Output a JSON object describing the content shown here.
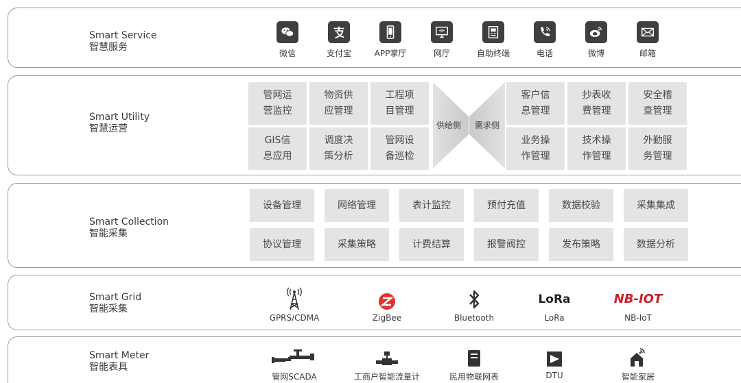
{
  "layers": {
    "service": {
      "en": "Smart Service",
      "zh": "智慧服务"
    },
    "utility": {
      "en": "Smart Utility",
      "zh": "智慧运营"
    },
    "collection": {
      "en": "Smart Collection",
      "zh": "智能采集"
    },
    "grid": {
      "en": "Smart Grid",
      "zh": "智能采集"
    },
    "meter": {
      "en": "Smart Meter",
      "zh": "智能表具"
    }
  },
  "service_items": [
    {
      "label": "微信",
      "icon": "wechat-icon"
    },
    {
      "label": "支付宝",
      "icon": "alipay-icon"
    },
    {
      "label": "APP掌厅",
      "icon": "mobile-app-icon"
    },
    {
      "label": "网厅",
      "icon": "monitor-icon"
    },
    {
      "label": "自助终端",
      "icon": "kiosk-icon"
    },
    {
      "label": "电话",
      "icon": "phone-icon"
    },
    {
      "label": "微博",
      "icon": "weibo-icon"
    },
    {
      "label": "邮箱",
      "icon": "mail-icon"
    }
  ],
  "utility": {
    "supply_side": "供给侧",
    "demand_side": "需求侧",
    "left_cells": [
      [
        "管网运",
        "营监控"
      ],
      [
        "物资供",
        "应管理"
      ],
      [
        "工程项",
        "目管理"
      ],
      [
        "GIS信",
        "息应用"
      ],
      [
        "调度决",
        "策分析"
      ],
      [
        "管网设",
        "备巡检"
      ]
    ],
    "right_cells": [
      [
        "客户信",
        "息管理"
      ],
      [
        "抄表收",
        "费管理"
      ],
      [
        "安全稽",
        "查管理"
      ],
      [
        "业务操",
        "作管理"
      ],
      [
        "技术操",
        "作管理"
      ],
      [
        "外勤服",
        "务管理"
      ]
    ]
  },
  "collection_cells": [
    "设备管理",
    "网络管理",
    "表计监控",
    "预付充值",
    "数据校验",
    "采集集成",
    "协议管理",
    "采集策略",
    "计费结算",
    "报警阀控",
    "发布策略",
    "数据分析"
  ],
  "grid_items": [
    {
      "label": "GPRS/CDMA",
      "icon": "cell-tower-icon"
    },
    {
      "label": "ZigBee",
      "icon": "zigbee-icon"
    },
    {
      "label": "Bluetooth",
      "icon": "bluetooth-icon"
    },
    {
      "label": "LoRa",
      "icon": "lora-logo",
      "logo_text": "LoRa"
    },
    {
      "label": "NB-IoT",
      "icon": "nbiot-logo",
      "logo_text": "NB-IOT"
    }
  ],
  "meter_items": [
    {
      "label": "管网SCADA",
      "icon": "pipeline-icon"
    },
    {
      "label": "工商户智能流量计",
      "icon": "flowmeter-icon"
    },
    {
      "label": "民用物联网表",
      "icon": "smart-meter-icon"
    },
    {
      "label": "DTU",
      "icon": "dtu-icon"
    },
    {
      "label": "智能家居",
      "icon": "smart-home-icon"
    }
  ],
  "colors": {
    "border": "#9a9a9a",
    "cell": "#e4e4e4",
    "icon": "#3f3f3f",
    "zigbee": "#e0332d",
    "nbiot": "#c8202a"
  }
}
